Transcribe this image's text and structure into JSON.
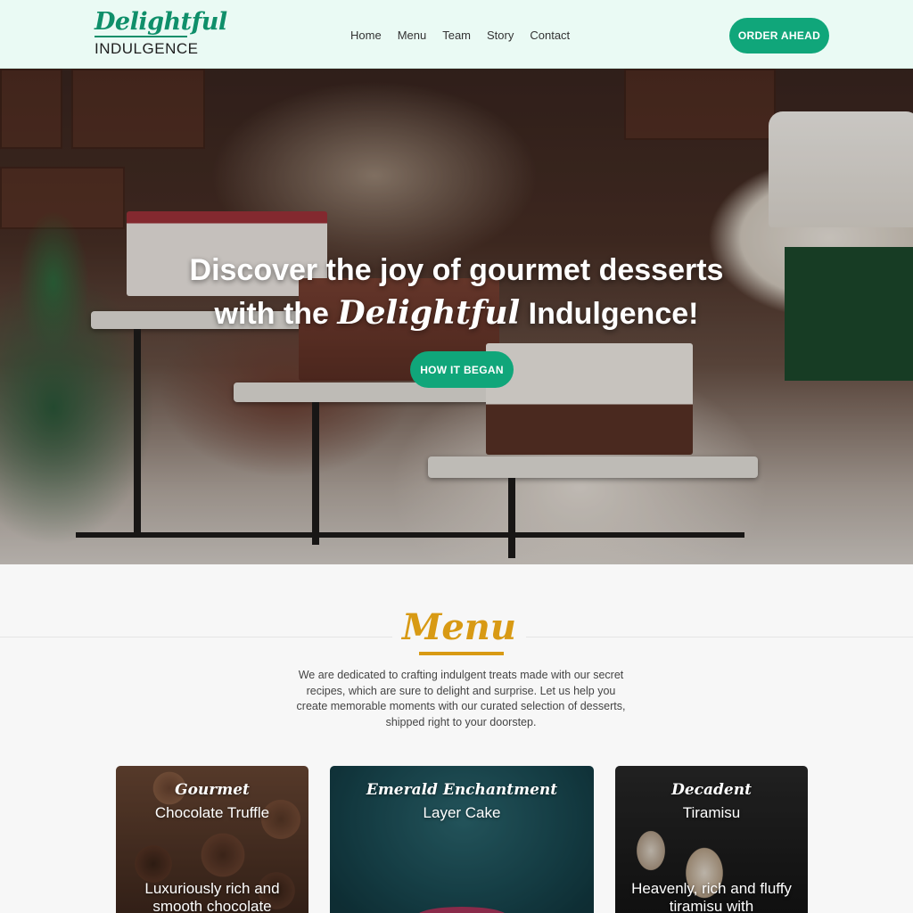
{
  "brand": {
    "script": "Delightful",
    "sub": "INDULGENCE",
    "primary_color": "#10a67a",
    "accent_color": "#d89a14"
  },
  "nav": {
    "items": [
      {
        "label": "Home"
      },
      {
        "label": "Menu"
      },
      {
        "label": "Team"
      },
      {
        "label": "Story"
      },
      {
        "label": "Contact"
      }
    ],
    "cta": "ORDER AHEAD"
  },
  "hero": {
    "line1": "Discover the joy of gourmet desserts",
    "line2_pre": "with the",
    "line2_script": "Delightful",
    "line2_post": "Indulgence!",
    "button": "HOW IT BEGAN"
  },
  "menu": {
    "title": "Menu",
    "description": "We are dedicated to crafting indulgent treats made with our secret recipes, which are sure to delight and surprise. Let us help you create memorable moments with our curated selection of desserts, shipped right to your doorstep."
  },
  "cards": [
    {
      "script": "Gourmet",
      "name": "Chocolate Truffle",
      "desc": "Luxuriously rich and smooth chocolate"
    },
    {
      "script": "Emerald Enchantment",
      "name": "Layer Cake",
      "desc": ""
    },
    {
      "script": "Decadent",
      "name": "Tiramisu",
      "desc": "Heavenly, rich and fluffy tiramisu with"
    }
  ]
}
